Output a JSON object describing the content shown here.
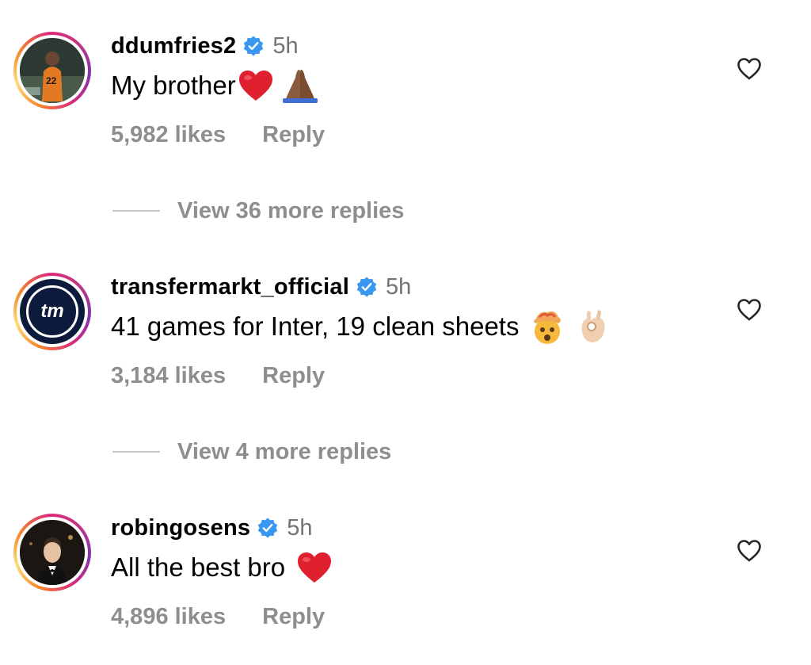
{
  "comments": [
    {
      "username": "ddumfries2",
      "time": "5h",
      "text": "My brother",
      "likes": "5,982 likes",
      "reply_label": "Reply",
      "view_replies": "View 36 more replies",
      "emojis": [
        "red-heart",
        "folded-hands"
      ]
    },
    {
      "username": "transfermarkt_official",
      "time": "5h",
      "text": "41 games for Inter, 19 clean sheets",
      "likes": "3,184 likes",
      "reply_label": "Reply",
      "view_replies": "View 4 more replies",
      "emojis": [
        "exploding-head",
        "ok-hand"
      ],
      "avatar_text": "tm"
    },
    {
      "username": "robingosens",
      "time": "5h",
      "text": "All the best bro",
      "likes": "4,896 likes",
      "reply_label": "Reply",
      "emojis": [
        "red-heart"
      ]
    }
  ],
  "colors": {
    "verified_blue": "#3897f0",
    "muted_text": "#8e8e8e",
    "heart_red": "#e0202f"
  }
}
